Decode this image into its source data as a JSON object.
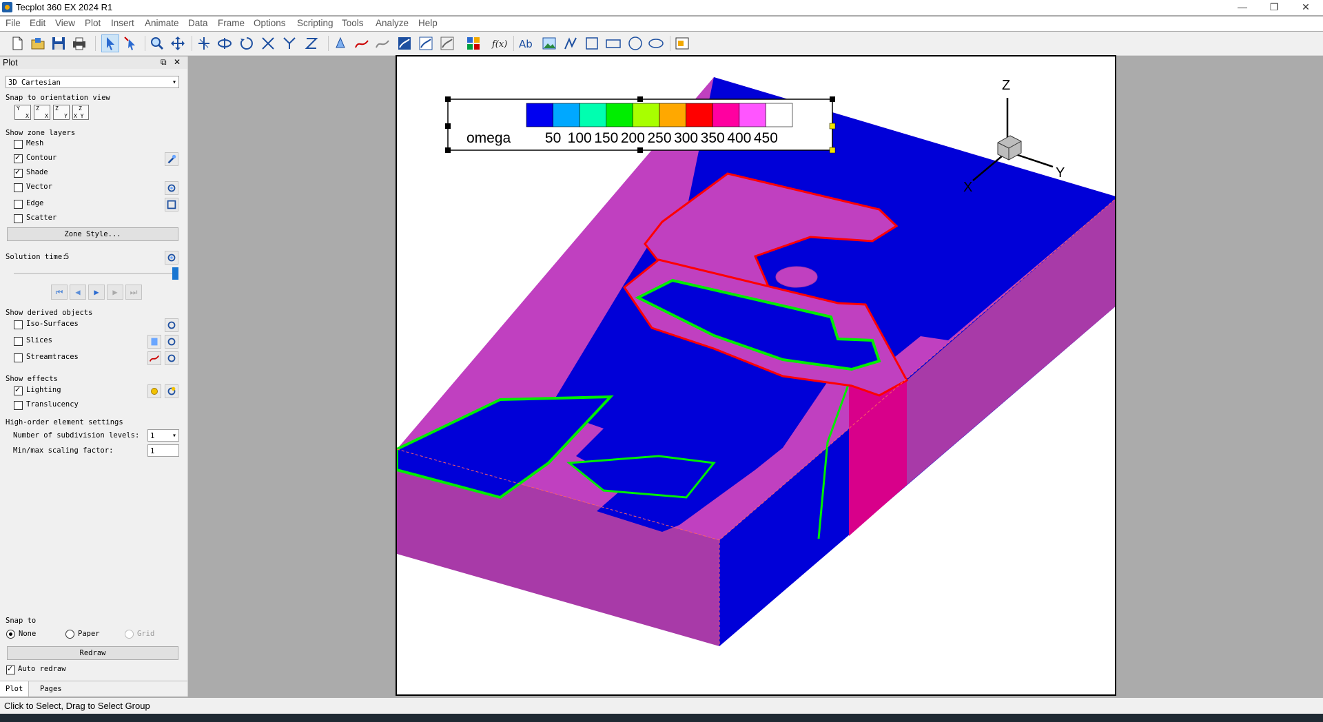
{
  "window": {
    "title": "Tecplot 360 EX 2024 R1",
    "controls": [
      "—",
      "❐",
      "✕"
    ]
  },
  "menu": [
    "File",
    "Edit",
    "View",
    "Plot",
    "Insert",
    "Animate",
    "Data",
    "Frame",
    "Options",
    "Scripting",
    "Tools",
    "Analyze",
    "Help"
  ],
  "panel": {
    "title": "Plot",
    "header_icons": [
      "⧉",
      "✕"
    ],
    "plot_type": "3D Cartesian",
    "snap_orientation_label": "Snap to orientation view",
    "snap_views": [
      {
        "top": "Y",
        "sub": "X"
      },
      {
        "top": "Z",
        "sub": "X"
      },
      {
        "top": "Z",
        "sub": "Y"
      },
      {
        "top": "Z",
        "sub": "X Y"
      }
    ],
    "zone_layers_label": "Show zone layers",
    "zone_layers": [
      {
        "label": "Mesh",
        "checked": false
      },
      {
        "label": "Contour",
        "checked": true
      },
      {
        "label": "Shade",
        "checked": true
      },
      {
        "label": "Vector",
        "checked": false
      },
      {
        "label": "Edge",
        "checked": false
      },
      {
        "label": "Scatter",
        "checked": false
      }
    ],
    "zone_style_button": "Zone Style...",
    "solution_time_label": "Solution time:",
    "solution_time_value": "5",
    "solution_time_fraction": 1.0,
    "derived_label": "Show derived objects",
    "derived": [
      {
        "label": "Iso-Surfaces",
        "checked": false
      },
      {
        "label": "Slices",
        "checked": false
      },
      {
        "label": "Streamtraces",
        "checked": false
      }
    ],
    "effects_label": "Show effects",
    "effects": [
      {
        "label": "Lighting",
        "checked": true
      },
      {
        "label": "Translucency",
        "checked": false
      }
    ],
    "high_order_label": "High-order element settings",
    "subdivision_label": "Number of subdivision levels:",
    "subdivision_value": "1",
    "scaling_label": "Min/max scaling factor:",
    "scaling_value": "1",
    "snap_to_label": "Snap to",
    "snap_options": [
      {
        "label": "None",
        "selected": true,
        "disabled": false
      },
      {
        "label": "Paper",
        "selected": false,
        "disabled": false
      },
      {
        "label": "Grid",
        "selected": false,
        "disabled": true
      }
    ],
    "redraw_button": "Redraw",
    "auto_redraw_label": "Auto redraw",
    "auto_redraw_checked": true,
    "tabs": [
      "Plot",
      "Pages"
    ]
  },
  "legend": {
    "variable": "omega",
    "labels": [
      "50",
      "100",
      "150",
      "200",
      "250",
      "300",
      "350",
      "400",
      "450"
    ],
    "colors": [
      "#0000f0",
      "#00a8ff",
      "#00ffb0",
      "#00ee00",
      "#a8ff00",
      "#ffa800",
      "#ff0000",
      "#ff00a0",
      "#ff55ff",
      "#ffffff"
    ]
  },
  "axes": {
    "x": "X",
    "y": "Y",
    "z": "Z"
  },
  "status": {
    "text": "Click to Select, Drag to Select Group"
  }
}
